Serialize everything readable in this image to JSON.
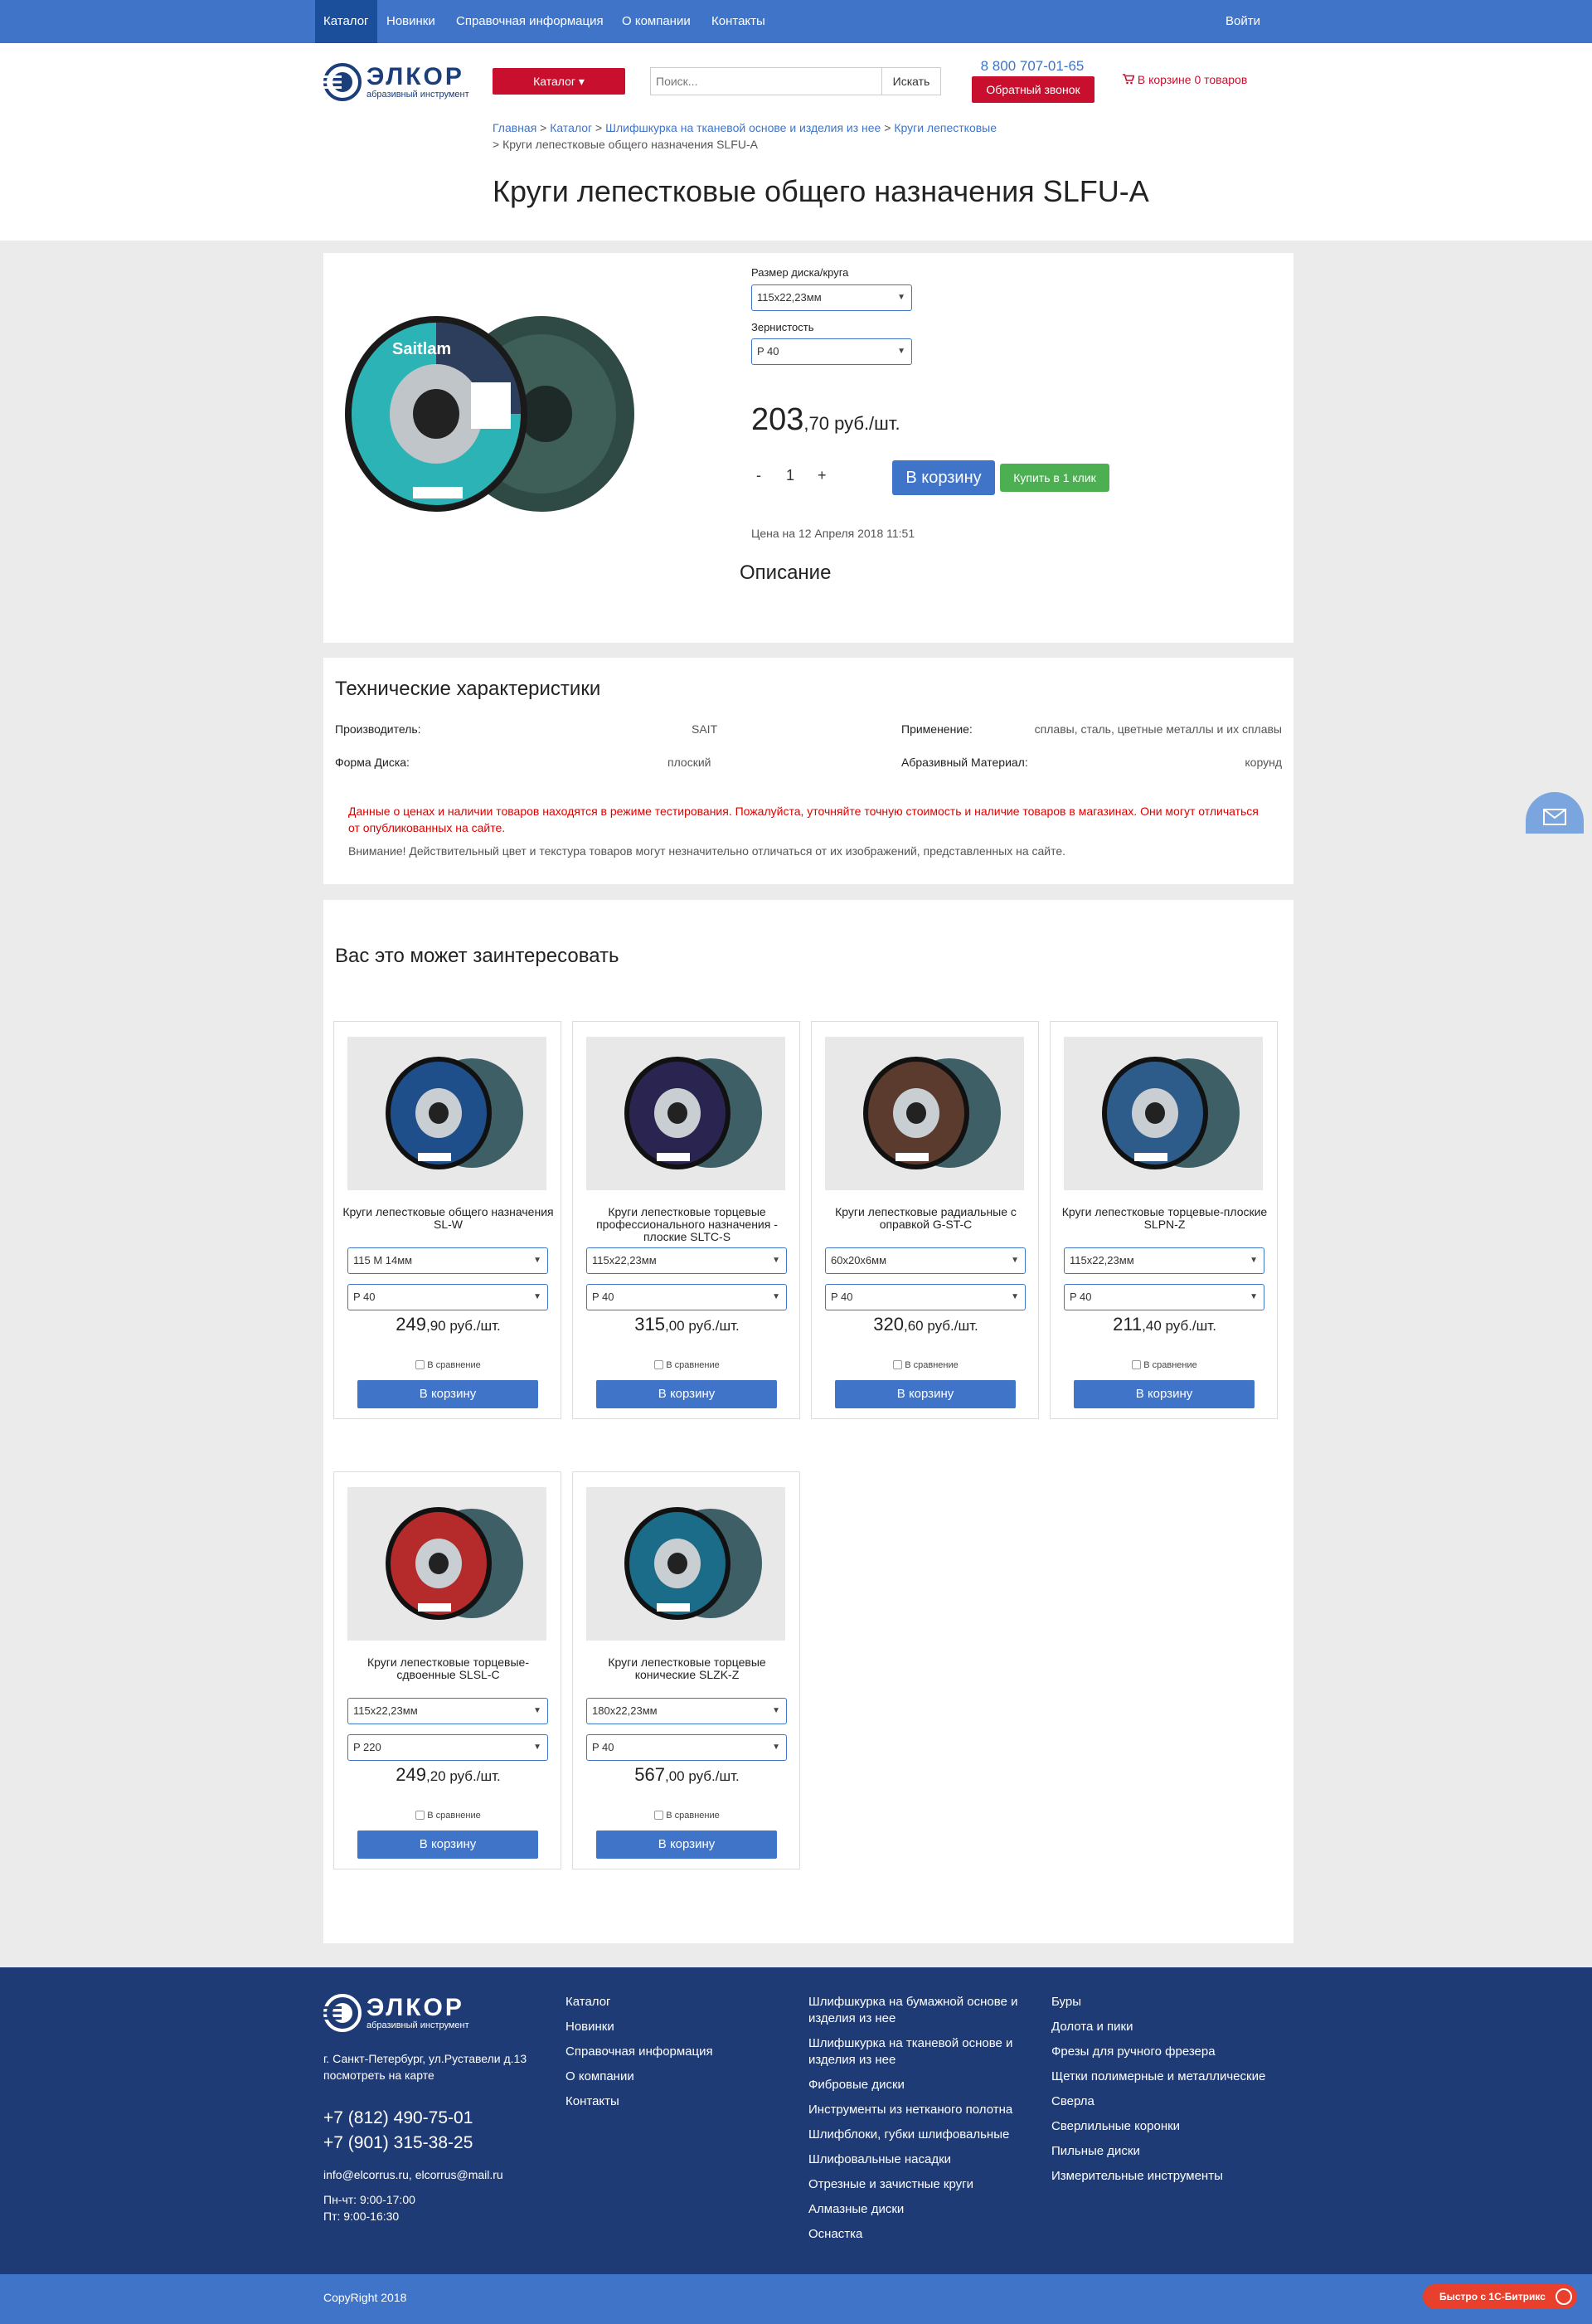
{
  "topnav": {
    "items": [
      "Каталог",
      "Новинки",
      "Справочная информация",
      "О компании",
      "Контакты"
    ],
    "login": "Войти"
  },
  "header": {
    "logo_text": "ЭЛКОР",
    "logo_sub": "абразивный инструмент",
    "catalog_button": "Каталог ▾",
    "search_placeholder": "Поиск...",
    "search_button": "Искать",
    "phone": "8 800 707-01-65",
    "callback_button": "Обратный звонок",
    "cart": "В корзине 0 товаров"
  },
  "breadcrumb": {
    "items": [
      "Главная",
      "Каталог",
      "Шлифшкурка на тканевой основе и изделия из нее",
      "Круги лепестковые"
    ],
    "current": "Круги лепестковые общего назначения SLFU-A"
  },
  "page_title": "Круги лепестковые общего назначения SLFU-A",
  "product": {
    "size_label": "Размер диска/круга",
    "size_value": "115x22,23мм",
    "grit_label": "Зернистость",
    "grit_value": "P 40",
    "price_int": "203",
    "price_frac": ",70 руб./шт.",
    "qty_minus": "-",
    "qty_value": "1",
    "qty_plus": "+",
    "cart_button": "В корзину",
    "oneclick_button": "Купить в 1 клик",
    "price_date": "Цена на 12 Апреля 2018 11:51",
    "description_title": "Описание"
  },
  "specs": {
    "title": "Технические характеристики",
    "rows": [
      {
        "key": "Производитель:",
        "value": "SAIT"
      },
      {
        "key": "Применение:",
        "value": "сплавы, сталь, цветные металлы и их сплавы"
      },
      {
        "key": "Форма Диска:",
        "value": "плоский"
      },
      {
        "key": "Абразивный Материал:",
        "value": "корунд"
      }
    ],
    "notice_red": "Данные о ценах и наличии товаров находятся в режиме тестирования. Пожалуйста, уточняйте точную стоимость и наличие товаров в магазинах. Они могут отличаться от опубликованных на сайте.",
    "notice_gray": "Внимание! Действительный цвет и текстура товаров могут незначительно отличаться от их изображений, представленных на сайте."
  },
  "reco": {
    "title": "Вас это может заинтересовать",
    "compare_label": "В сравнение",
    "cart_button": "В корзину",
    "items": [
      {
        "name": "Круги лепестковые общего назначения SL-W",
        "size": "115 M 14мм",
        "grit": "P 40",
        "price_int": "249",
        "price_frac": ",90 руб./шт."
      },
      {
        "name": "Круги лепестковые торцевые профессионального назначения - плоские SLTC-S",
        "size": "115x22,23мм",
        "grit": "P 40",
        "price_int": "315",
        "price_frac": ",00 руб./шт."
      },
      {
        "name": "Круги лепестковые радиальные с оправкой G-ST-C",
        "size": "60x20x6мм",
        "grit": "P 40",
        "price_int": "320",
        "price_frac": ",60 руб./шт."
      },
      {
        "name": "Круги лепестковые торцевые-плоские SLPN-Z",
        "size": "115x22,23мм",
        "grit": "P 40",
        "price_int": "211",
        "price_frac": ",40 руб./шт."
      },
      {
        "name": "Круги лепестковые торцевые-сдвоенные SLSL-C",
        "size": "115x22,23мм",
        "grit": "P 220",
        "price_int": "249",
        "price_frac": ",20 руб./шт."
      },
      {
        "name": "Круги лепестковые торцевые конические SLZK-Z",
        "size": "180x22,23мм",
        "grit": "P 40",
        "price_int": "567",
        "price_frac": ",00 руб./шт."
      }
    ]
  },
  "footer": {
    "address": "г. Санкт-Петербург, ул.Руставели д.13",
    "map_link": "посмотреть на карте",
    "phone1": "+7 (812) 490-75-01",
    "phone2": "+7 (901) 315-38-25",
    "email": "info@elcorrus.ru, elcorrus@mail.ru",
    "hours1": "Пн-чт: 9:00-17:00",
    "hours2": "Пт: 9:00-16:30",
    "col1": [
      "Каталог",
      "Новинки",
      "Справочная информация",
      "О компании",
      "Контакты"
    ],
    "col2": [
      "Шлифшкурка на бумажной основе и изделия из нее",
      "Шлифшкурка на тканевой основе и изделия из нее",
      "Фибровые диски",
      "Инструменты из нетканого полотна",
      "Шлифблоки, губки шлифовальные",
      "Шлифовальные насадки",
      "Отрезные и зачистные круги",
      "Алмазные диски",
      "Оснастка"
    ],
    "col3": [
      "Буры",
      "Долота и пики",
      "Фрезы для ручного фрезера",
      "Щетки полимерные и металлические",
      "Сверла",
      "Сверлильные коронки",
      "Пильные диски",
      "Измерительные инструменты"
    ],
    "copyright": "CopyRight 2018",
    "bitrix": "Быстро с 1С-Битрикс"
  },
  "colors": {
    "primary": "#3f74c8",
    "accent": "#c8102e",
    "green": "#4cb052",
    "footer": "#1e3b75"
  }
}
